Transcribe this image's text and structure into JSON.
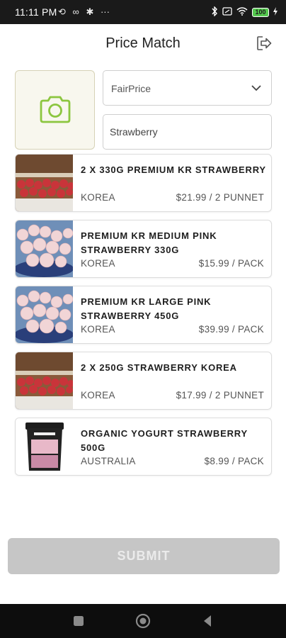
{
  "status_bar": {
    "time": "11:11 PM",
    "battery": "100"
  },
  "header": {
    "title": "Price Match"
  },
  "store_select": {
    "value": "FairPrice"
  },
  "search": {
    "value": "Strawberry"
  },
  "products": [
    {
      "name": "2 X 330G PREMIUM KR STRAWBERRY",
      "origin": "KOREA",
      "price": "$21.99 / 2 PUNNET",
      "image": "red-strawberry-box"
    },
    {
      "name": "PREMIUM KR MEDIUM PINK STRAWBERRY 330G",
      "origin": "KOREA",
      "price": "$15.99 / PACK",
      "image": "pink-strawberry-bowl"
    },
    {
      "name": "PREMIUM KR LARGE PINK STRAWBERRY 450G",
      "origin": "KOREA",
      "price": "$39.99 / PACK",
      "image": "pink-strawberry-bowl"
    },
    {
      "name": "2 X 250G STRAWBERRY KOREA",
      "origin": "KOREA",
      "price": "$17.99 / 2 PUNNET",
      "image": "red-strawberry-box"
    },
    {
      "name": "ORGANIC YOGURT STRAWBERRY 500G",
      "origin": "AUSTRALIA",
      "price": "$8.99 / PACK",
      "image": "yogurt-tub"
    }
  ],
  "submit": {
    "label": "SUBMIT"
  },
  "colors": {
    "accent_green": "#8cc63f",
    "disabled_button": "#c6c6c6",
    "status_bar": "#1a1a1a"
  },
  "icons": [
    "camera-icon",
    "logout-icon",
    "chevron-down-icon",
    "wifi-icon",
    "bluetooth-icon",
    "battery-icon",
    "nav-square-icon",
    "nav-home-icon",
    "nav-back-icon"
  ]
}
